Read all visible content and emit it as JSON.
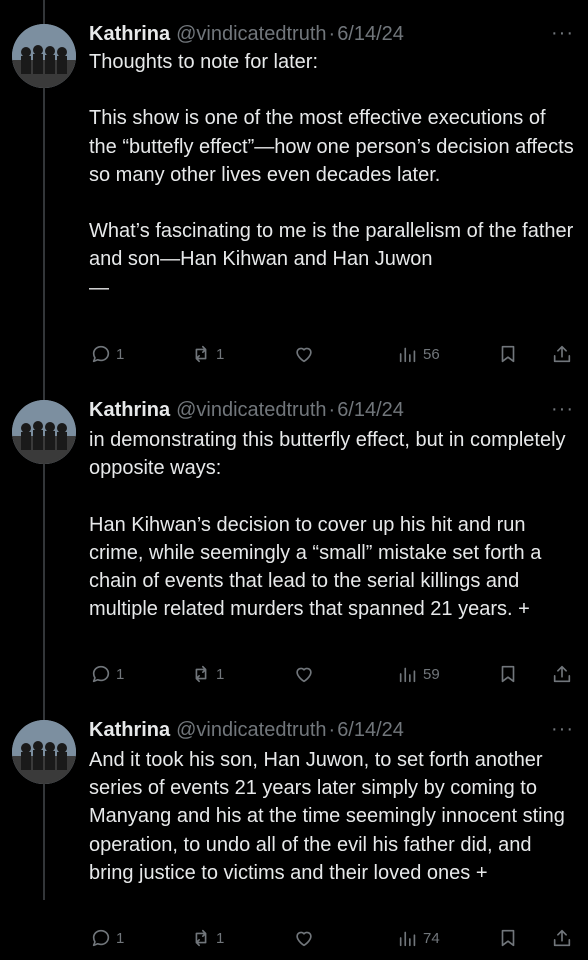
{
  "tweets": [
    {
      "name": "Kathrina",
      "handle": "@vindicatedtruth",
      "separator": "·",
      "date": "6/14/24",
      "more": "···",
      "text": "Thoughts to note for later:\n\nThis show is one of the most effective executions of the “buttefly effect”—how one person’s decision affects so many other lives even decades later.\n\nWhat’s fascinating to me is the parallelism of the father and son—Han Kihwan and Han Juwon\n—",
      "replies": "1",
      "retweets": "1",
      "views": "56"
    },
    {
      "name": "Kathrina",
      "handle": "@vindicatedtruth",
      "separator": "·",
      "date": "6/14/24",
      "more": "···",
      "text": "in demonstrating this butterfly effect, but in completely opposite ways:\n\nHan Kihwan’s decision to cover up his hit and run crime, while seemingly a “small” mistake set forth a chain of events that lead to the serial killings and multiple related murders that spanned 21 years. +",
      "replies": "1",
      "retweets": "1",
      "views": "59"
    },
    {
      "name": "Kathrina",
      "handle": "@vindicatedtruth",
      "separator": "·",
      "date": "6/14/24",
      "more": "···",
      "text": "And it took his son, Han Juwon, to set forth another series of events 21 years later simply by coming to Manyang and his at the time seemingly innocent sting operation, to undo all of the evil his father did, and bring justice to victims and their loved ones +",
      "replies": "1",
      "retweets": "1",
      "views": "74"
    }
  ],
  "icons": {
    "reply": "reply-icon",
    "retweet": "retweet-icon",
    "like": "like-icon",
    "views": "views-icon",
    "bookmark": "bookmark-icon",
    "share": "share-icon",
    "more": "more-icon"
  },
  "colors": {
    "background": "#000000",
    "text": "#e7e9ea",
    "secondary": "#71767b",
    "thread_line": "#333639"
  }
}
